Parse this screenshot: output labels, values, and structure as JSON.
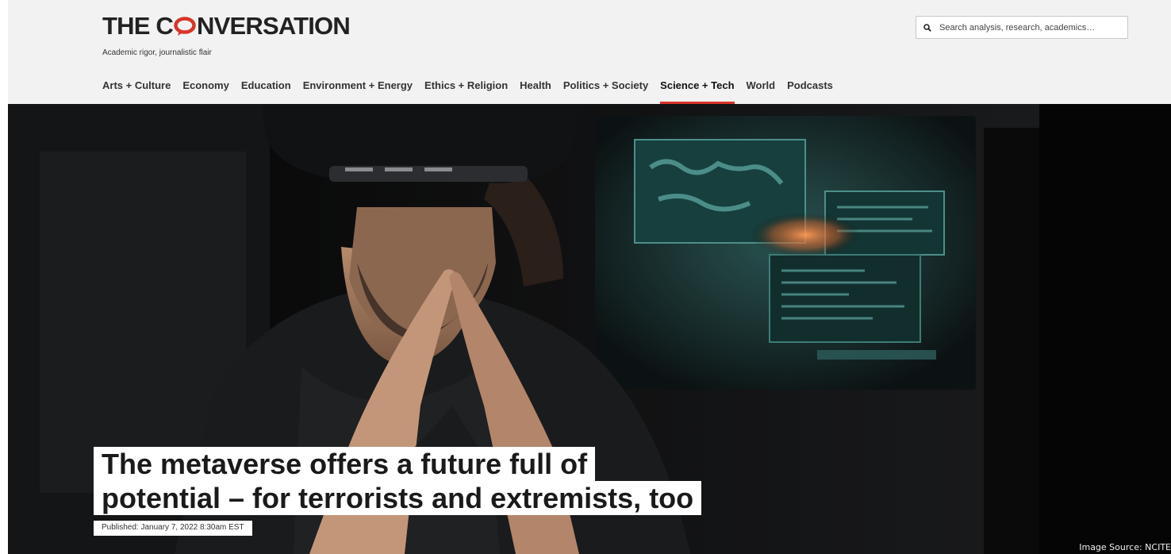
{
  "site": {
    "logo_text_before": "THE C",
    "logo_text_after": "NVERSATION",
    "tagline": "Academic rigor, journalistic flair",
    "brand_color": "#d8352a"
  },
  "search": {
    "placeholder": "Search analysis, research, academics…",
    "icon": "search-icon"
  },
  "nav": {
    "items": [
      {
        "label": "Arts + Culture",
        "active": false
      },
      {
        "label": "Economy",
        "active": false
      },
      {
        "label": "Education",
        "active": false
      },
      {
        "label": "Environment + Energy",
        "active": false
      },
      {
        "label": "Ethics + Religion",
        "active": false
      },
      {
        "label": "Health",
        "active": false
      },
      {
        "label": "Politics + Society",
        "active": false
      },
      {
        "label": "Science + Tech",
        "active": true
      },
      {
        "label": "World",
        "active": false
      },
      {
        "label": "Podcasts",
        "active": false
      }
    ]
  },
  "article": {
    "headline_line1": "The metaverse offers a future full of",
    "headline_line2": "potential – for terrorists and extremists, too",
    "published": "Published: January 7, 2022 8:30am EST"
  },
  "image_credit": "Image Source: NCITE"
}
